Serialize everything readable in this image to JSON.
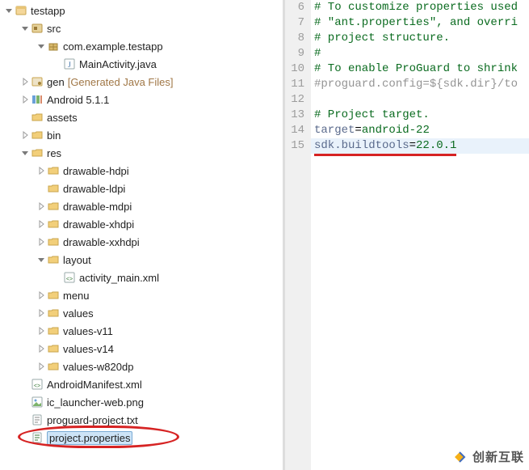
{
  "tree": [
    {
      "depth": 0,
      "arrow": "down",
      "icon": "project",
      "label": "testapp"
    },
    {
      "depth": 1,
      "arrow": "down",
      "icon": "src",
      "label": "src"
    },
    {
      "depth": 2,
      "arrow": "down",
      "icon": "package",
      "label": "com.example.testapp"
    },
    {
      "depth": 3,
      "arrow": "none",
      "icon": "java",
      "label": "MainActivity.java"
    },
    {
      "depth": 1,
      "arrow": "right",
      "icon": "gen",
      "label": "gen",
      "suffix": "[Generated Java Files]"
    },
    {
      "depth": 1,
      "arrow": "right",
      "icon": "lib",
      "label": "Android 5.1.1"
    },
    {
      "depth": 1,
      "arrow": "none",
      "icon": "folder",
      "label": "assets"
    },
    {
      "depth": 1,
      "arrow": "right",
      "icon": "folder",
      "label": "bin"
    },
    {
      "depth": 1,
      "arrow": "down",
      "icon": "folder",
      "label": "res"
    },
    {
      "depth": 2,
      "arrow": "right",
      "icon": "folder",
      "label": "drawable-hdpi"
    },
    {
      "depth": 2,
      "arrow": "none",
      "icon": "folder",
      "label": "drawable-ldpi"
    },
    {
      "depth": 2,
      "arrow": "right",
      "icon": "folder",
      "label": "drawable-mdpi"
    },
    {
      "depth": 2,
      "arrow": "right",
      "icon": "folder",
      "label": "drawable-xhdpi"
    },
    {
      "depth": 2,
      "arrow": "right",
      "icon": "folder",
      "label": "drawable-xxhdpi"
    },
    {
      "depth": 2,
      "arrow": "down",
      "icon": "folder",
      "label": "layout"
    },
    {
      "depth": 3,
      "arrow": "none",
      "icon": "xml",
      "label": "activity_main.xml"
    },
    {
      "depth": 2,
      "arrow": "right",
      "icon": "folder",
      "label": "menu"
    },
    {
      "depth": 2,
      "arrow": "right",
      "icon": "folder",
      "label": "values"
    },
    {
      "depth": 2,
      "arrow": "right",
      "icon": "folder",
      "label": "values-v11"
    },
    {
      "depth": 2,
      "arrow": "right",
      "icon": "folder",
      "label": "values-v14"
    },
    {
      "depth": 2,
      "arrow": "right",
      "icon": "folder",
      "label": "values-w820dp"
    },
    {
      "depth": 1,
      "arrow": "none",
      "icon": "xml",
      "label": "AndroidManifest.xml"
    },
    {
      "depth": 1,
      "arrow": "none",
      "icon": "png",
      "label": "ic_launcher-web.png"
    },
    {
      "depth": 1,
      "arrow": "none",
      "icon": "txt",
      "label": "proguard-project.txt"
    },
    {
      "depth": 1,
      "arrow": "none",
      "icon": "props",
      "label": "project.properties",
      "selected": true,
      "circled": true
    }
  ],
  "code": {
    "lines": [
      {
        "n": 6,
        "t": "# To customize properties used"
      },
      {
        "n": 7,
        "t": "# \"ant.properties\", and overri"
      },
      {
        "n": 8,
        "t": "# project structure."
      },
      {
        "n": 9,
        "t": "#"
      },
      {
        "n": 10,
        "t": "# To enable ProGuard to shrink"
      },
      {
        "n": 11,
        "t": "#proguard.config=${sdk.dir}/to"
      },
      {
        "n": 12,
        "t": ""
      },
      {
        "n": 13,
        "t": "# Project target."
      },
      {
        "n": 14,
        "key": "target",
        "sep": "=",
        "val": "android-22"
      },
      {
        "n": 15,
        "key": "sdk.buildtools",
        "sep": "=",
        "val": "22.0.1",
        "hl": true,
        "underline": true
      }
    ]
  },
  "watermark": "创新互联"
}
